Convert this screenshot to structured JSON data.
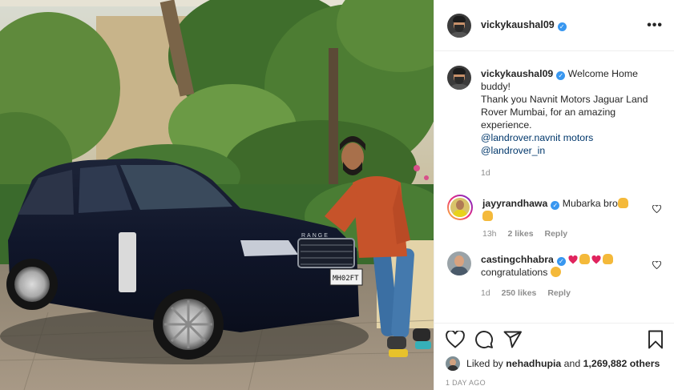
{
  "post": {
    "author": "vickykaushal09",
    "verified_mark": "✓",
    "more_label": "•••"
  },
  "caption": {
    "username": "vickykaushal09",
    "line1": "Welcome Home buddy!",
    "line2": "Thank you Navnit Motors Jaguar Land Rover Mumbai, for an amazing experience.",
    "mention1": "@landrover.navnit",
    "mention1_suffix": "motors",
    "mention2": "@landrover_in",
    "time": "1d"
  },
  "comments": [
    {
      "username": "jayyrandhawa",
      "text": "Mubarka bro",
      "emoji": [
        "raised-hands-emoji",
        "raised-hands-emoji"
      ],
      "time": "13h",
      "likes": "2 likes",
      "reply": "Reply"
    },
    {
      "username": "castingchhabra",
      "emoji_line": [
        "red-heart-emoji",
        "raised-hands-emoji",
        "red-heart-emoji",
        "raised-hands-emoji"
      ],
      "text": "congratulations",
      "trailing_emoji": "clapping-hands-emoji",
      "time": "1d",
      "likes": "250 likes",
      "reply": "Reply"
    }
  ],
  "engagement": {
    "liked_by_prefix": "Liked by",
    "liked_by_user": "nehadhupia",
    "and": "and",
    "others": "1,269,882 others",
    "posted_ago": "1 DAY AGO"
  },
  "photo": {
    "plate": "MH02FT",
    "brand_letters": "RANGE"
  },
  "colors": {
    "verified": "#3897f0",
    "mention": "#00376b",
    "muted": "#8e8e8e",
    "border": "#efefef",
    "heart_red": "#ed4956"
  }
}
